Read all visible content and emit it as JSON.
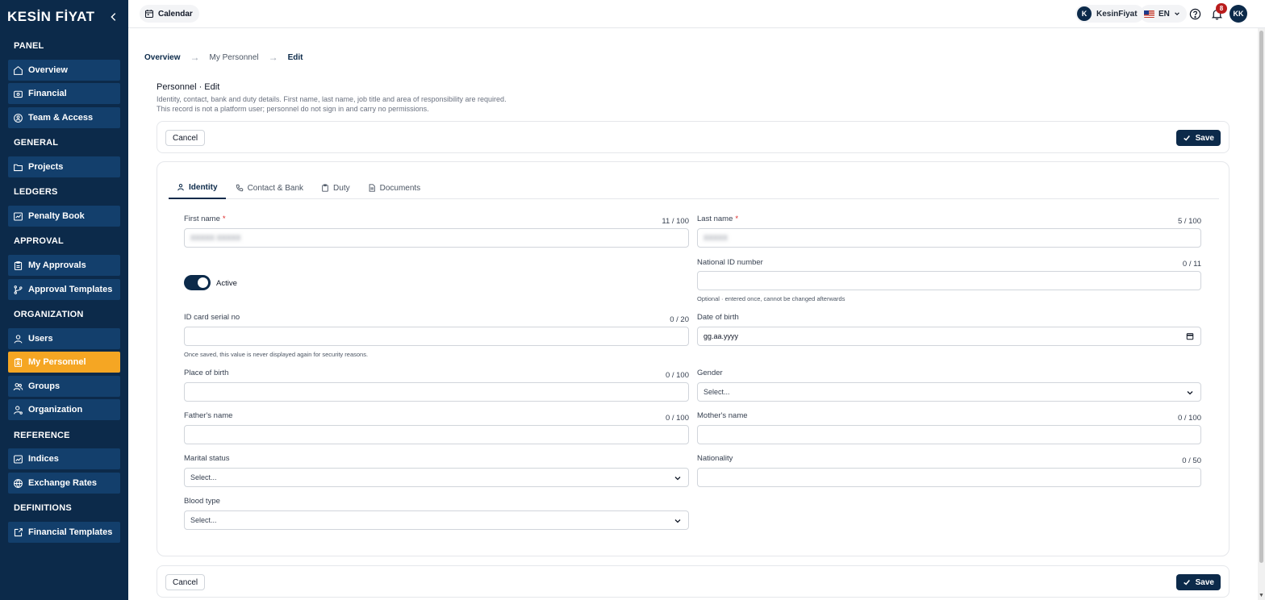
{
  "app": {
    "logo_text": "KESİN FİYAT"
  },
  "sidebar": {
    "sections": [
      {
        "title": "PANEL",
        "items": [
          {
            "label": "Overview",
            "icon": "home-icon"
          },
          {
            "label": "Financial",
            "icon": "wallet-icon"
          },
          {
            "label": "Team & Access",
            "icon": "shield-user-icon"
          }
        ]
      },
      {
        "title": "GENERAL",
        "items": [
          {
            "label": "Projects",
            "icon": "folder-icon"
          }
        ]
      },
      {
        "title": "LEDGERS",
        "items": [
          {
            "label": "Penalty Book",
            "icon": "book-icon"
          }
        ]
      },
      {
        "title": "APPROVAL",
        "items": [
          {
            "label": "My Approvals",
            "icon": "clipboard-check-icon"
          },
          {
            "label": "Approval Templates",
            "icon": "git-branch-icon"
          }
        ]
      },
      {
        "title": "ORGANIZATION",
        "items": [
          {
            "label": "Users",
            "icon": "user-icon"
          },
          {
            "label": "My Personnel",
            "icon": "clipboard-user-icon",
            "active": true
          },
          {
            "label": "Groups",
            "icon": "users-icon"
          },
          {
            "label": "Organization",
            "icon": "user-cog-icon"
          }
        ]
      },
      {
        "title": "REFERENCE",
        "items": [
          {
            "label": "Indices",
            "icon": "trend-chart-icon"
          },
          {
            "label": "Exchange Rates",
            "icon": "globe-icon"
          }
        ]
      },
      {
        "title": "DEFINITIONS",
        "items": [
          {
            "label": "Financial Templates",
            "icon": "external-square-icon"
          }
        ]
      }
    ]
  },
  "topbar": {
    "calendar_label": "Calendar",
    "user_initial": "K",
    "user_name": "KesinFiyat",
    "language": "EN",
    "notification_count": "8",
    "avatar_initials": "KK"
  },
  "breadcrumb": {
    "items": [
      "Overview",
      "My Personnel",
      "Edit"
    ]
  },
  "page": {
    "title": "Personnel · Edit",
    "desc_line1": "Identity, contact, bank and duty details. First name, last name, job title and area of responsibility are required.",
    "desc_line2": "This record is not a platform user; personnel do not sign in and carry no permissions."
  },
  "actions": {
    "cancel_label": "Cancel",
    "save_label": "Save"
  },
  "tabs": [
    {
      "label": "Identity",
      "icon": "user-icon",
      "active": true
    },
    {
      "label": "Contact & Bank",
      "icon": "phone-icon"
    },
    {
      "label": "Duty",
      "icon": "clipboard-icon"
    },
    {
      "label": "Documents",
      "icon": "document-icon"
    }
  ],
  "form": {
    "first_name": {
      "label": "First name",
      "counter": "11 / 100",
      "value": "XXXXX XXXXX"
    },
    "last_name": {
      "label": "Last name",
      "counter": "5 / 100",
      "value": "XXXXX"
    },
    "active_toggle": {
      "label": "Active",
      "on": true
    },
    "national_id": {
      "label": "National ID number",
      "counter": "0 / 11",
      "value": "",
      "hint": "Optional · entered once, cannot be changed afterwards"
    },
    "id_serial": {
      "label": "ID card serial no",
      "counter": "0 / 20",
      "value": "",
      "hint": "Once saved, this value is never displayed again for security reasons."
    },
    "date_of_birth": {
      "label": "Date of birth",
      "placeholder": "gg.aa.yyyy"
    },
    "place_of_birth": {
      "label": "Place of birth",
      "counter": "0 / 100",
      "value": ""
    },
    "gender": {
      "label": "Gender",
      "selected": "Select..."
    },
    "father_name": {
      "label": "Father's name",
      "counter": "0 / 100",
      "value": ""
    },
    "mother_name": {
      "label": "Mother's name",
      "counter": "0 / 100",
      "value": ""
    },
    "marital_status": {
      "label": "Marital status",
      "selected": "Select..."
    },
    "nationality": {
      "label": "Nationality",
      "counter": "0 / 50",
      "value": ""
    },
    "blood_type": {
      "label": "Blood type",
      "selected": "Select..."
    }
  },
  "colors": {
    "sidebar_bg": "#0c2a4a",
    "nav_item_bg": "#133f6c",
    "active_nav": "#f5a623",
    "primary": "#0c2a4a",
    "required": "#dc2626",
    "badge": "#b91c1c"
  }
}
